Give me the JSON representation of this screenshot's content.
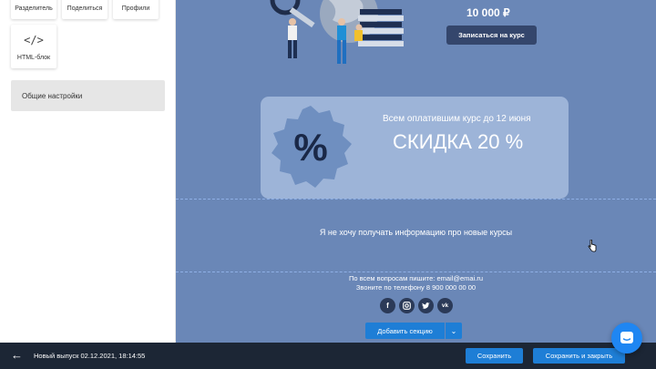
{
  "left_panel": {
    "tiles": [
      {
        "label": "Разделитель"
      },
      {
        "label": "Поделиться"
      },
      {
        "label": "Профили"
      },
      {
        "label": "HTML-блок",
        "icon": "code-icon"
      }
    ],
    "general_settings": "Общие настройки"
  },
  "email": {
    "price": "10 000 ₽",
    "enroll_button": "Записаться на курс",
    "promo": {
      "subtitle": "Всем оплатившим курс до 12 июня",
      "title": "СКИДКА 20 %",
      "badge_symbol": "%"
    },
    "unsubscribe": "Я не хочу получать информацию про новые курсы",
    "footer": {
      "contact_line": "По всем вопросам пишите: email@emai.ru",
      "phone_line": "Звоните по телефону  8 900 000 00 00",
      "socials": [
        "facebook-icon",
        "instagram-icon",
        "twitter-icon",
        "vk-icon"
      ]
    },
    "add_section": "Добавить секцию"
  },
  "bottom_bar": {
    "title": "Новый выпуск 02.12.2021, 18:14:55",
    "save": "Сохранить",
    "save_and_close": "Сохранить и закрыть"
  },
  "colors": {
    "canvas_bg": "#6a87b7",
    "promo_bg": "#9db4d8",
    "accent": "#1e7ed6",
    "dark_bar": "#1c2635"
  }
}
